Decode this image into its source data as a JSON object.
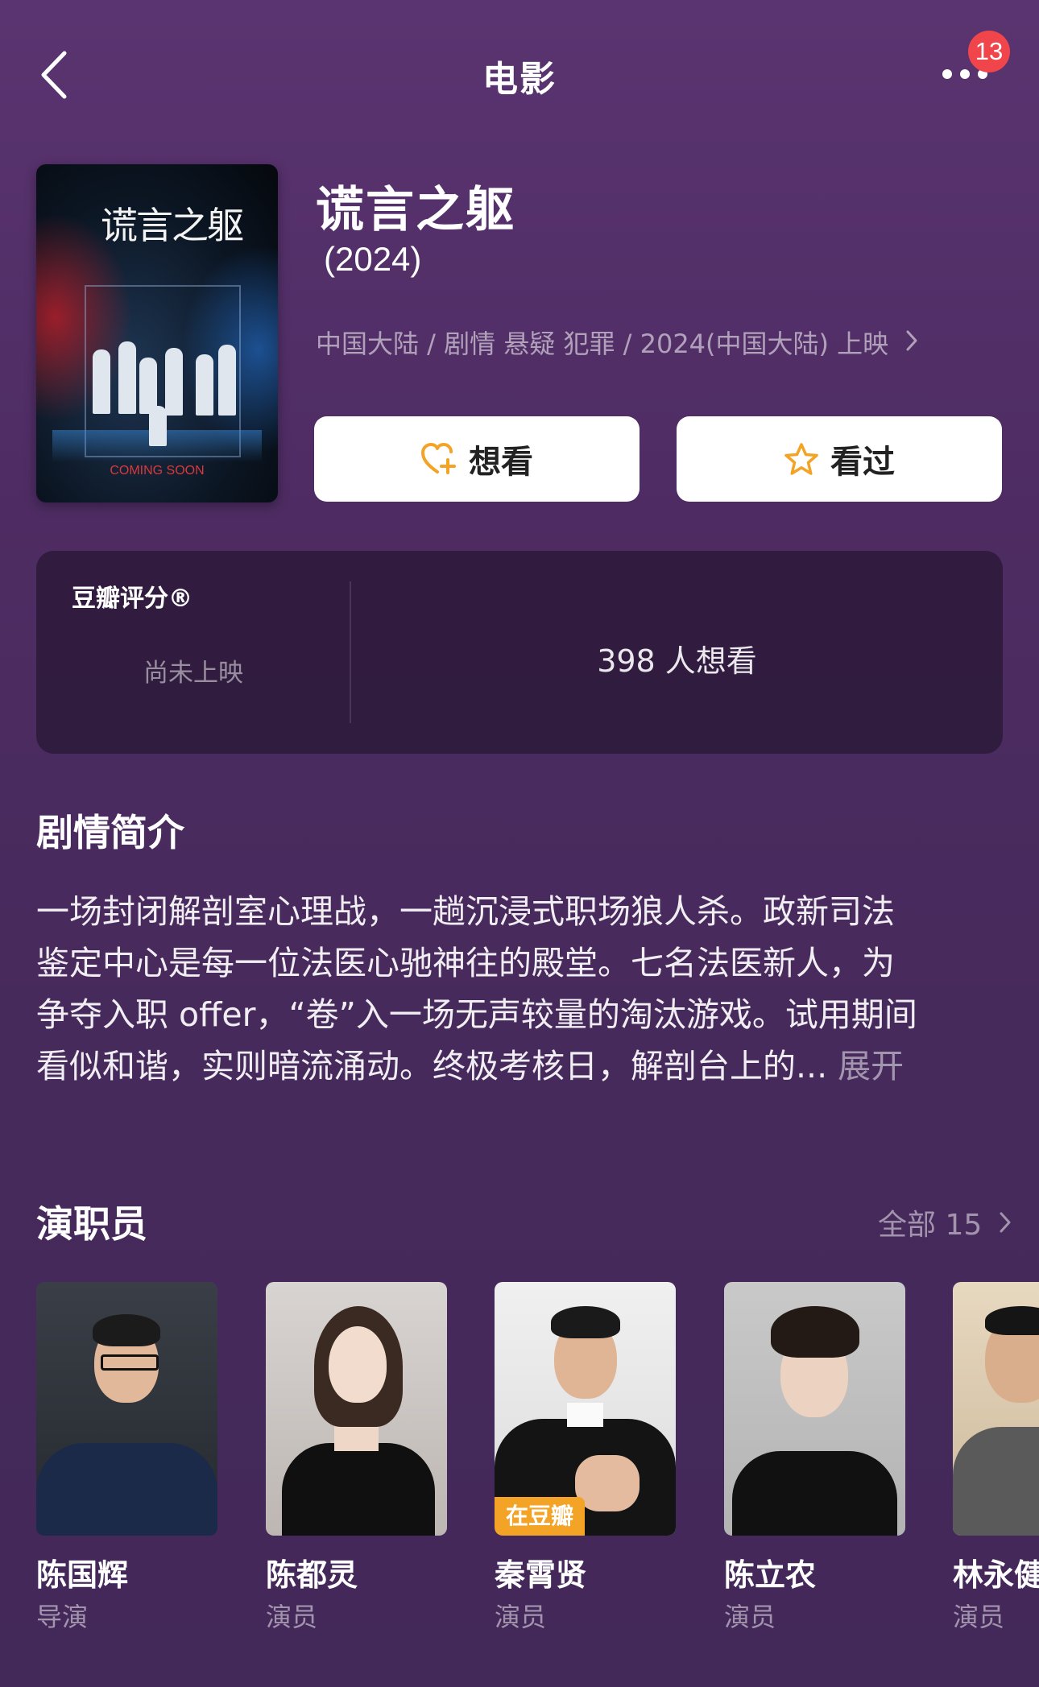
{
  "header": {
    "title": "电影",
    "badge_count": "13"
  },
  "movie": {
    "poster_title": "谎言之躯",
    "poster_coming": "COMING SOON",
    "title": "谎言之躯",
    "year": "(2024)",
    "meta": "中国大陆 / 剧情 悬疑 犯罪 / 2024(中国大陆) 上映",
    "want_label": "想看",
    "seen_label": "看过"
  },
  "rating": {
    "label": "豆瓣评分®",
    "status": "尚未上映",
    "want_count": "398 人想看"
  },
  "synopsis": {
    "title": "剧情简介",
    "lines": [
      "一场封闭解剖室心理战，一趟沉浸式职场狼人杀。政新司法",
      "鉴定中心是每一位法医心驰神往的殿堂。七名法医新人，为",
      "争夺入职 offer，“卷”入一场无声较量的淘汰游戏。试用期间",
      "看似和谐，实则暗流涌动。终极考核日，解剖台上的... "
    ],
    "expand": "展开"
  },
  "cast": {
    "title": "演职员",
    "all_label": "全部 15",
    "members": [
      {
        "name": "陈国辉",
        "role": "导演"
      },
      {
        "name": "陈都灵",
        "role": "演员"
      },
      {
        "name": "秦霄贤",
        "role": "演员",
        "badge": "在豆瓣"
      },
      {
        "name": "陈立农",
        "role": "演员"
      },
      {
        "name": "林永健",
        "role": "演员"
      }
    ]
  },
  "colors": {
    "accent_orange": "#f3a325",
    "badge_red": "#f0454a",
    "bg": "#4e2c63"
  }
}
